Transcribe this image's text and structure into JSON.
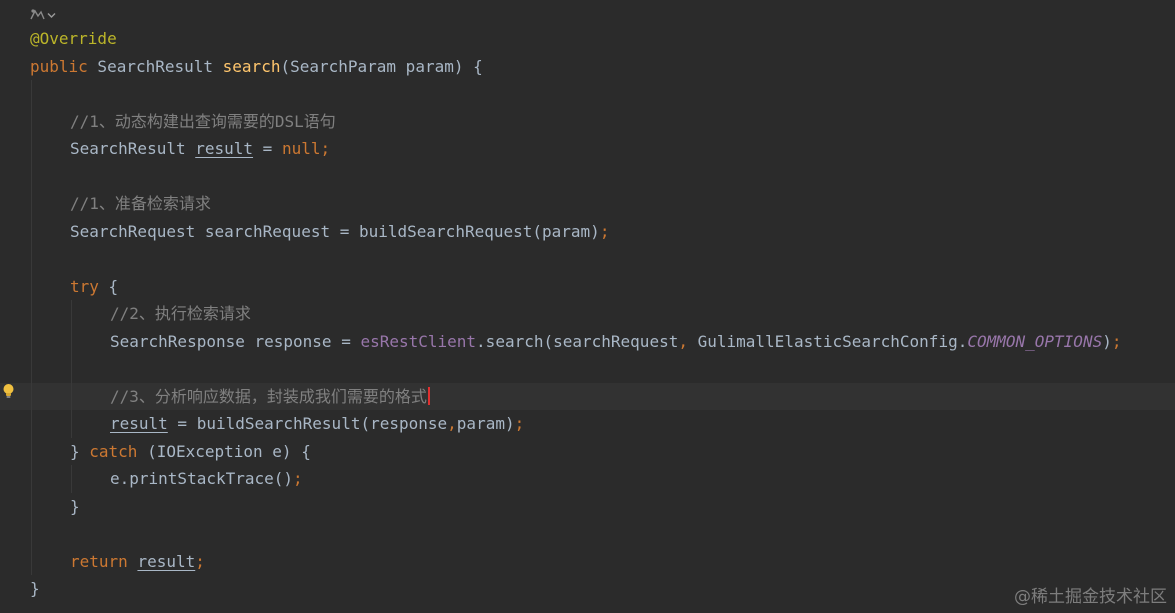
{
  "editor": {
    "gutter_hint_icon": "gutter-usage-icon",
    "lightbulb_icon": "intention-bulb-icon",
    "lines": [
      [
        {
          "t": "@Override",
          "c": "ann"
        }
      ],
      [
        {
          "t": "public",
          "c": "kw"
        },
        {
          "t": " SearchResult "
        },
        {
          "t": "search",
          "c": "fn"
        },
        {
          "t": "(SearchParam param) {"
        }
      ],
      [],
      [
        {
          "t": "//1、动态构建出查询需要的DSL语句",
          "c": "cm"
        }
      ],
      [
        {
          "t": "SearchResult "
        },
        {
          "t": "result",
          "c": "ul"
        },
        {
          "t": " = "
        },
        {
          "t": "null",
          "c": "kw"
        },
        {
          "t": ";",
          "c": "kw"
        }
      ],
      [],
      [
        {
          "t": "//1、准备检索请求",
          "c": "cm"
        }
      ],
      [
        {
          "t": "SearchRequest searchRequest = buildSearchRequest(param)"
        },
        {
          "t": ";",
          "c": "kw"
        }
      ],
      [],
      [
        {
          "t": "try",
          "c": "kw"
        },
        {
          "t": " {"
        }
      ],
      [
        {
          "t": "//2、执行检索请求",
          "c": "cm"
        }
      ],
      [
        {
          "t": "SearchResponse response = "
        },
        {
          "t": "esRestClient",
          "c": "field"
        },
        {
          "t": ".search(searchRequest"
        },
        {
          "t": ",",
          "c": "kw"
        },
        {
          "t": " GulimallElasticSearchConfig."
        },
        {
          "t": "COMMON_OPTIONS",
          "c": "const"
        },
        {
          "t": ")"
        },
        {
          "t": ";",
          "c": "kw"
        }
      ],
      [],
      [
        {
          "t": "//3、分析响应数据，封装成我们需要的格式",
          "c": "cm"
        }
      ],
      [
        {
          "t": "result",
          "c": "ul"
        },
        {
          "t": " = buildSearchResult(response"
        },
        {
          "t": ",",
          "c": "kw"
        },
        {
          "t": "param)"
        },
        {
          "t": ";",
          "c": "kw"
        }
      ],
      [
        {
          "t": "} "
        },
        {
          "t": "catch",
          "c": "kw"
        },
        {
          "t": " (IOException e) {"
        }
      ],
      [
        {
          "t": "e.printStackTrace()"
        },
        {
          "t": ";",
          "c": "kw"
        }
      ],
      [
        {
          "t": "}"
        }
      ],
      [],
      [
        {
          "t": "return",
          "c": "kw"
        },
        {
          "t": " "
        },
        {
          "t": "result",
          "c": "ul"
        },
        {
          "t": ";",
          "c": "kw"
        }
      ],
      [
        {
          "t": "}"
        }
      ]
    ]
  },
  "watermark": {
    "text": "@稀土掘金技术社区"
  }
}
